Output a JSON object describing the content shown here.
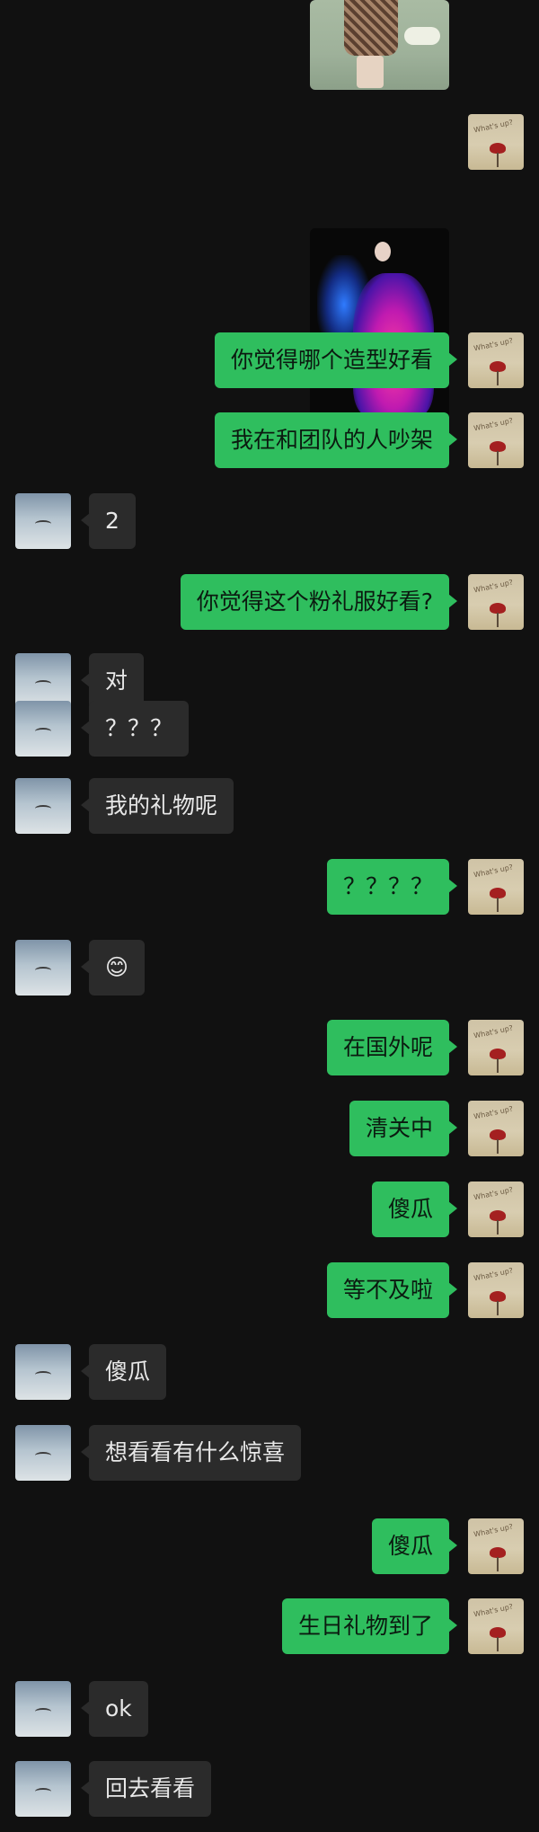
{
  "self_avatar_text": "What's up?",
  "messages": [
    {
      "side": "out",
      "type": "image",
      "photo": "photo-1"
    },
    {
      "side": "out",
      "type": "image",
      "photo": "photo-2"
    },
    {
      "side": "out",
      "text": "你觉得哪个造型好看"
    },
    {
      "side": "out",
      "text": "我在和团队的人吵架"
    },
    {
      "side": "in",
      "text": "2"
    },
    {
      "side": "out",
      "text": "你觉得这个粉礼服好看?"
    },
    {
      "side": "in",
      "text": "对"
    },
    {
      "side": "in",
      "text": "？？？"
    },
    {
      "side": "in",
      "text": "我的礼物呢"
    },
    {
      "side": "out",
      "text": "？？？？"
    },
    {
      "side": "in",
      "text": "😊"
    },
    {
      "side": "out",
      "text": "在国外呢"
    },
    {
      "side": "out",
      "text": "清关中"
    },
    {
      "side": "out",
      "text": "傻瓜"
    },
    {
      "side": "out",
      "text": "等不及啦"
    },
    {
      "side": "in",
      "text": "傻瓜"
    },
    {
      "side": "in",
      "text": "想看看有什么惊喜"
    },
    {
      "side": "out",
      "text": "傻瓜"
    },
    {
      "side": "out",
      "text": "生日礼物到了"
    },
    {
      "side": "in",
      "text": "ok"
    },
    {
      "side": "in",
      "text": "回去看看"
    }
  ]
}
